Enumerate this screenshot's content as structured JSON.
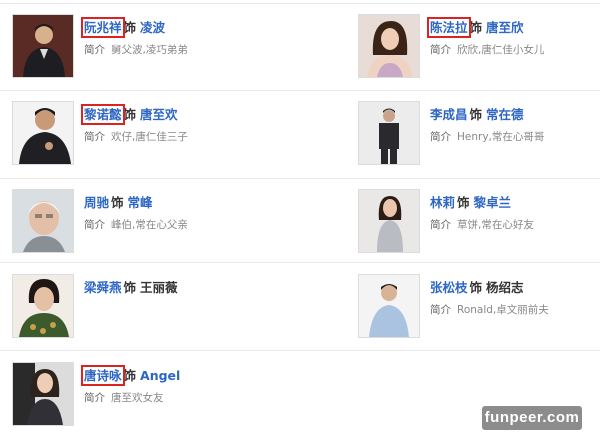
{
  "role_word": "饰",
  "intro_label": "简介",
  "cast": [
    {
      "actor": "阮兆祥",
      "role": "凌波",
      "intro": "舅父波,凌巧弟弟",
      "highlighted": true,
      "photo_icon": "man-portrait"
    },
    {
      "actor": "陈法拉",
      "role": "唐至欣",
      "intro": "欣欣,唐仁佳小女儿",
      "highlighted": true,
      "photo_icon": "woman-portrait"
    },
    {
      "actor": "黎诺懿",
      "role": "唐至欢",
      "intro": "欢仔,唐仁佳三子",
      "highlighted": true,
      "photo_icon": "man-portrait"
    },
    {
      "actor": "李成昌",
      "role": "常在德",
      "intro": "Henry,常在心哥哥",
      "highlighted": false,
      "photo_icon": "man-portrait"
    },
    {
      "actor": "周驰",
      "role": "常峰",
      "intro": "峰伯,常在心父亲",
      "highlighted": false,
      "photo_icon": "elder-man-portrait"
    },
    {
      "actor": "林莉",
      "role": "黎卓兰",
      "intro": "草饼,常在心好友",
      "highlighted": false,
      "photo_icon": "woman-portrait"
    },
    {
      "actor": "梁舜燕",
      "role": "王丽薇",
      "intro": "",
      "highlighted": false,
      "photo_icon": "elder-woman-portrait"
    },
    {
      "actor": "张松枝",
      "role": "杨绍志",
      "intro": "Ronald,卓文丽前夫",
      "highlighted": false,
      "photo_icon": "man-portrait"
    },
    {
      "actor": "唐诗咏",
      "role": "Angel",
      "intro": "唐至欢女友",
      "highlighted": true,
      "photo_icon": "woman-portrait"
    }
  ],
  "watermark": "funpeer.com",
  "colors": {
    "link": "#2d66c4",
    "highlight_box": "#dd2222",
    "muted_text": "#888888"
  }
}
